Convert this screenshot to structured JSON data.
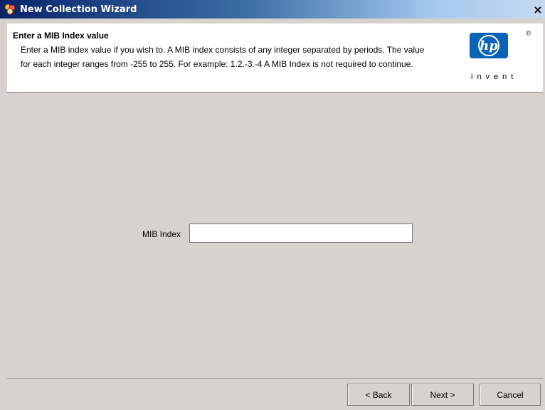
{
  "window": {
    "title": "New Collection Wizard",
    "close_glyph": "×"
  },
  "header": {
    "title": "Enter a MIB Index value",
    "description": "Enter a MIB index value if you wish to. A MIB index consists of any integer separated by periods. The value for each integer ranges from -255 to 255. For example: 1.2.-3.-4 A MIB Index is not required to continue.",
    "logo": {
      "text": "hp",
      "tagline": "invent",
      "registered": "®",
      "color": "#0a63b6"
    }
  },
  "form": {
    "mib_index_label": "MIB Index",
    "mib_index_value": "",
    "mib_index_placeholder": ""
  },
  "buttons": {
    "back_label": "< Back",
    "next_label": "Next >",
    "cancel_label": "Cancel"
  },
  "colors": {
    "title_bar": "#0a246a",
    "background": "#d6d3ce",
    "header_bg": "#ffffff"
  }
}
